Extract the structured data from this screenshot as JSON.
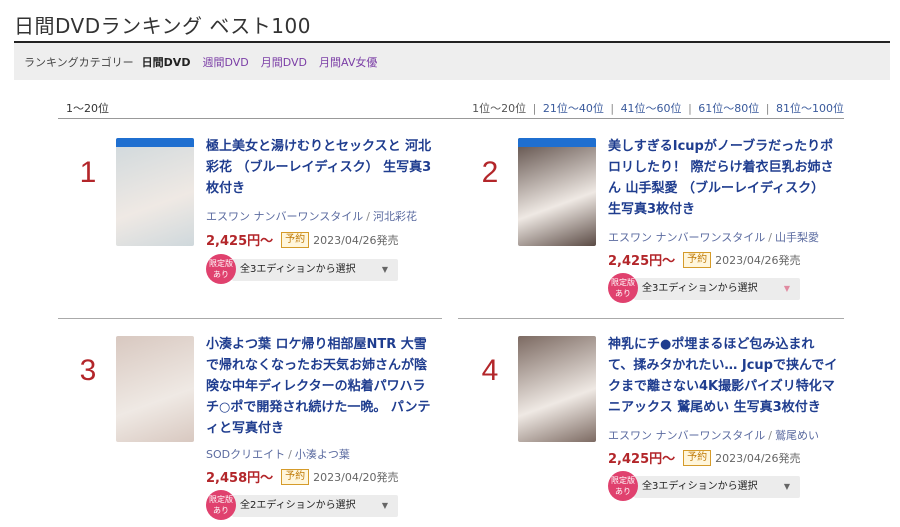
{
  "page_title": "日間DVDランキング ベスト100",
  "category_bar": {
    "label": "ランキングカテゴリー",
    "current": "日間DVD",
    "links": [
      "週間DVD",
      "月間DVD",
      "月間AV女優"
    ]
  },
  "range": {
    "current": "1〜20位",
    "links": [
      "1位〜20位",
      "21位〜40位",
      "41位〜60位",
      "61位〜80位",
      "81位〜100位"
    ],
    "separator": "|"
  },
  "items": [
    {
      "rank": "1",
      "title": "極上美女と湯けむりとセックスと 河北彩花 （ブルーレイディスク） 生写真3枚付き",
      "maker": "エスワン ナンバーワンスタイル",
      "actress": "河北彩花",
      "price": "2,425円〜",
      "badge": "予約",
      "date": "2023/04/26発売",
      "limited_badge": "限定版あり",
      "edition_select": "全3エディションから選択",
      "cover_color": "#cfd8dc"
    },
    {
      "rank": "2",
      "title": "美しすぎるIcupがノーブラだったりポロリしたり！ 際だらけ着衣巨乳お姉さん 山手梨愛 （ブルーレイディスク） 生写真3枚付き",
      "maker": "エスワン ナンバーワンスタイル",
      "actress": "山手梨愛",
      "price": "2,425円〜",
      "badge": "予約",
      "date": "2023/04/26発売",
      "limited_badge": "限定版あり",
      "edition_select": "全3エディションから選択",
      "cover_color": "#5a4a44"
    },
    {
      "rank": "3",
      "title": "小湊よつ葉 ロケ帰り相部屋NTR 大雪で帰れなくなったお天気お姉さんが陰険な中年ディレクターの粘着パワハラチ○ポで開発され続けた一晩。 パンティと写真付き",
      "maker": "SODクリエイト",
      "actress": "小湊よつ葉",
      "price": "2,458円〜",
      "badge": "予約",
      "date": "2023/04/20発売",
      "limited_badge": "限定版あり",
      "edition_select": "全2エディションから選択",
      "cover_color": "#d8c8c0"
    },
    {
      "rank": "4",
      "title": "神乳にチ●ポ埋まるほど包み込まれて、揉みタかれたい… Jcupで挟んでイクまで離さない4K撮影パイズリ特化マニアックス 鷲尾めい 生写真3枚付き",
      "maker": "エスワン ナンバーワンスタイル",
      "actress": "鷲尾めい",
      "price": "2,425円〜",
      "badge": "予約",
      "date": "2023/04/26発売",
      "limited_badge": "限定版あり",
      "edition_select": "全3エディションから選択",
      "cover_color": "#7c6a62"
    }
  ]
}
